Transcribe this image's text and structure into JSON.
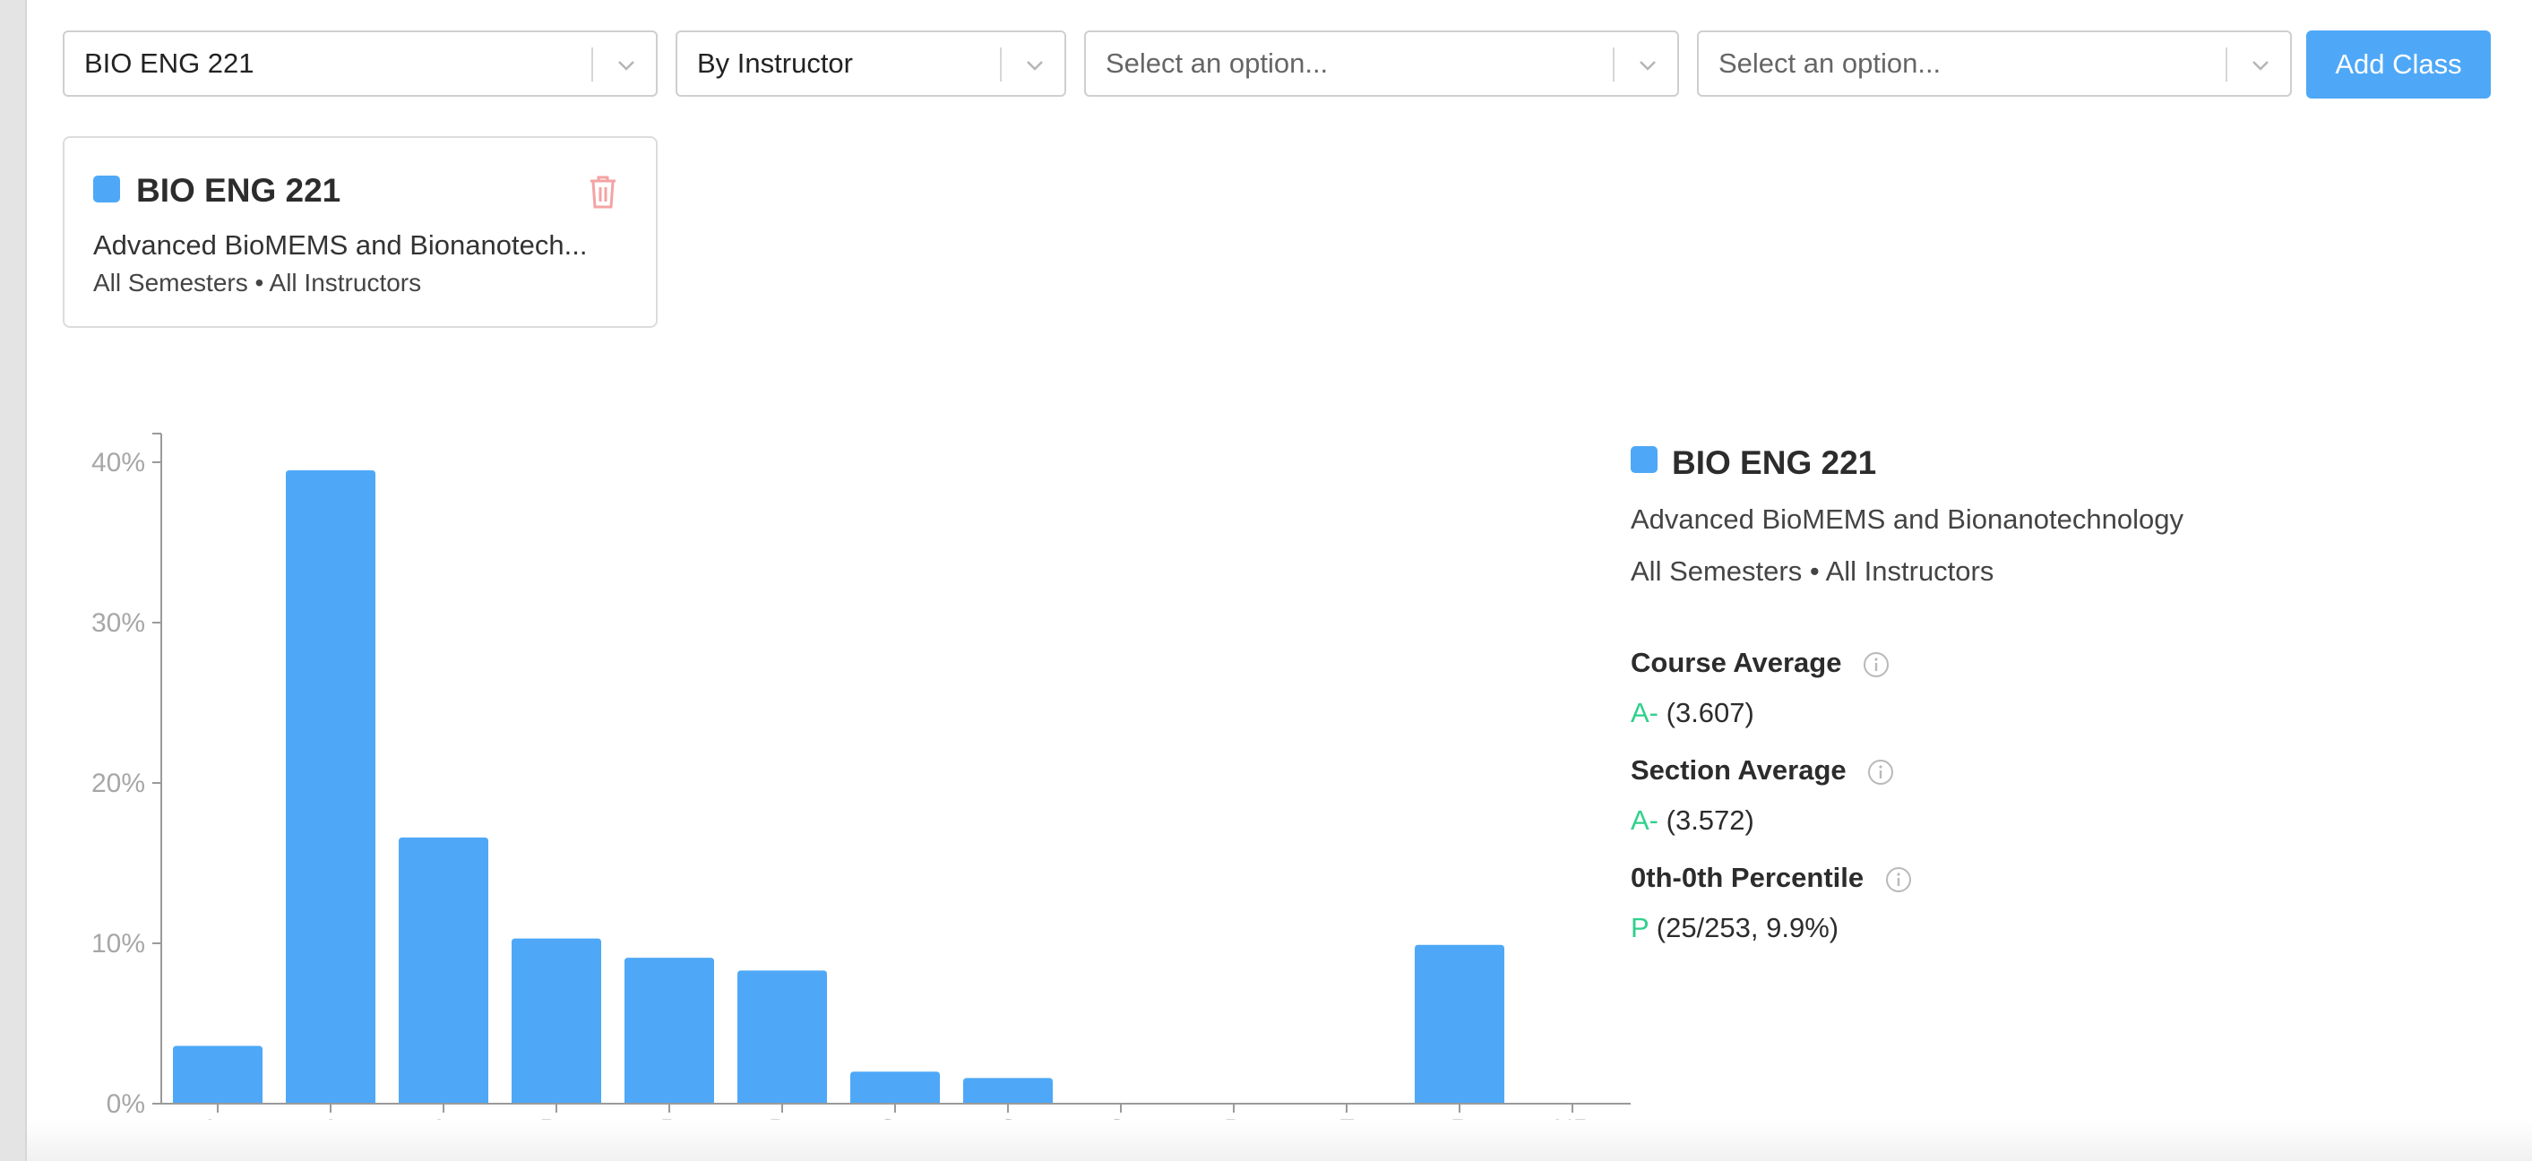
{
  "filters": {
    "course": {
      "value": "BIO ENG 221"
    },
    "group_by": {
      "value": "By Instructor"
    },
    "option_1": {
      "placeholder": "Select an option..."
    },
    "option_2": {
      "placeholder": "Select an option..."
    },
    "add_class_label": "Add Class"
  },
  "class_card": {
    "code": "BIO ENG 221",
    "name": "Advanced BioMEMS and Bionanotech...",
    "meta": "All Semesters • All Instructors",
    "color": "#4ea8f7",
    "delete_icon": "trash-icon"
  },
  "chart_data": {
    "type": "bar",
    "categories": [
      "A+",
      "A",
      "A-",
      "B+",
      "B",
      "B-",
      "C+",
      "C",
      "C-",
      "D",
      "F",
      "P",
      "NP"
    ],
    "series": [
      {
        "values": [
          3.6,
          39.5,
          16.6,
          10.3,
          9.1,
          8.3,
          2.0,
          1.6,
          0,
          0,
          0,
          9.9,
          0
        ],
        "color": "#4ea8f7"
      }
    ],
    "y_ticks": [
      "0%",
      "10%",
      "20%",
      "30%",
      "40%"
    ],
    "ylim": [
      0,
      40
    ],
    "grid": false
  },
  "summary": {
    "code": "BIO ENG 221",
    "name": "Advanced BioMEMS and Bionanotechnology",
    "meta": "All Semesters • All Instructors",
    "course_average": {
      "label": "Course Average",
      "grade": "A-",
      "value": "(3.607)"
    },
    "section_average": {
      "label": "Section Average",
      "grade": "A-",
      "value": "(3.572)"
    },
    "percentile": {
      "label": "0th-0th Percentile",
      "grade": "P",
      "value": "(25/253, 9.9%)"
    }
  }
}
